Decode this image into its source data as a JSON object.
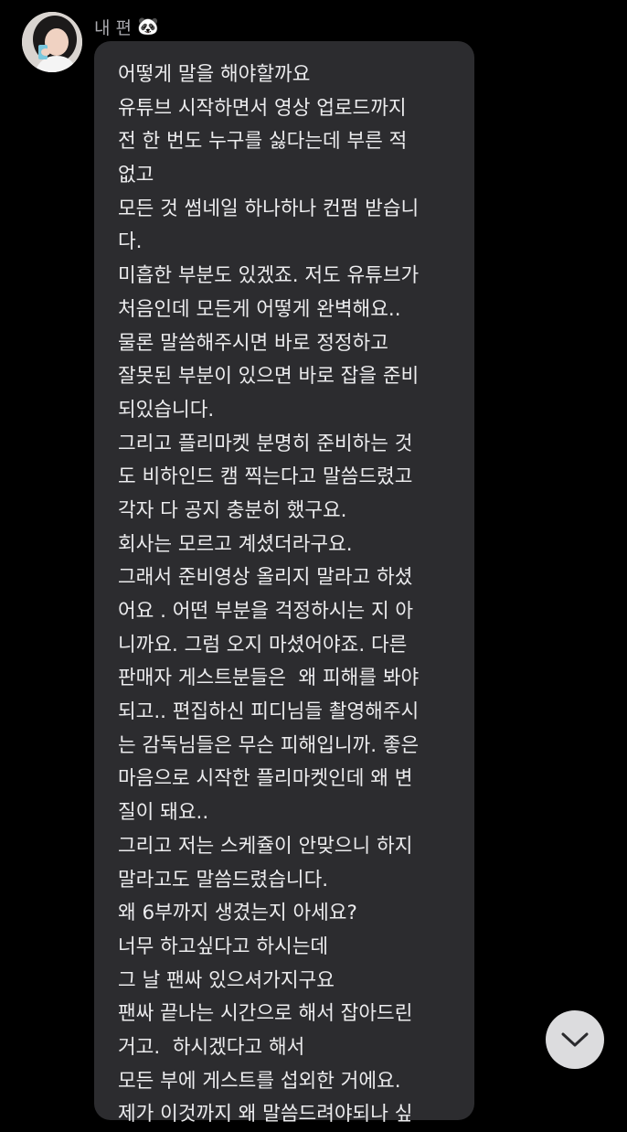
{
  "sender": {
    "name": "내 편",
    "emoji": "🐼"
  },
  "message": {
    "lines": [
      "어떻게 말을 해야할까요",
      "유튜브 시작하면서 영상 업로드까지",
      "전 한 번도 누구를 싫다는데 부른 적",
      "없고",
      "모든 것 썸네일 하나하나 컨펌 받습니",
      "다.",
      "미흡한 부분도 있겠죠. 저도 유튜브가",
      "처음인데 모든게 어떻게 완벽해요..",
      "물론 말씀해주시면 바로 정정하고",
      "잘못된 부분이 있으면 바로 잡을 준비",
      "되있습니다.",
      "그리고 플리마켓 분명히 준비하는 것",
      "도 비하인드 캠 찍는다고 말씀드렸고",
      "각자 다 공지 충분히 했구요.",
      "회사는 모르고 계셨더라구요.",
      "그래서 준비영상 올리지 말라고 하셨",
      "어요 . 어떤 부분을 걱정하시는 지 아",
      "니까요. 그럼 오지 마셨어야죠. 다른",
      "판매자 게스트분들은  왜 피해를 봐야",
      "되고.. 편집하신 피디님들 촬영해주시",
      "는 감독님들은 무슨 피해입니까. 좋은",
      "마음으로 시작한 플리마켓인데 왜 변",
      "질이 돼요..",
      "그리고 저는 스케쥴이 안맞으니 하지",
      "말라고도 말씀드렸습니다.",
      "왜 6부까지 생겼는지 아세요?",
      "너무 하고싶다고 하시는데",
      "그 날 팬싸 있으셔가지구요",
      "팬싸 끝나는 시간으로 해서 잡아드린",
      "거고.  하시겠다고 해서",
      "모든 부에 게스트를 섭외한 거에요.",
      "제가 이것까지 왜 말씀드려야되나 싶"
    ]
  },
  "icons": {
    "avatar": "profile-photo",
    "scroll": "chevron-down-icon"
  },
  "colors": {
    "background": "#000000",
    "bubble": "#2c2c2f",
    "text": "#ececee",
    "sender": "#a9a9ae",
    "scroll_button": "#dcdcde"
  }
}
